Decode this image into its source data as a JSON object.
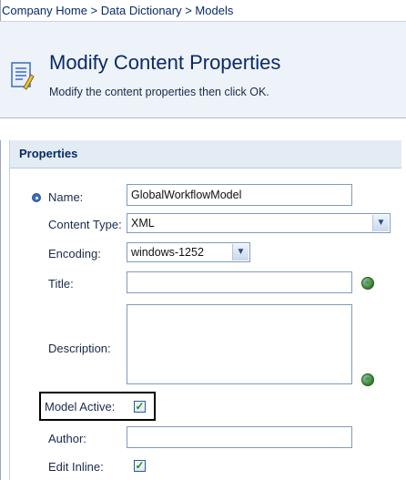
{
  "breadcrumb": {
    "text": "Company Home > Data Dictionary > Models"
  },
  "header": {
    "title": "Modify Content Properties",
    "subtitle": "Modify the content properties then click OK.",
    "icon": "document-edit-icon"
  },
  "panel": {
    "title": "Properties"
  },
  "form": {
    "name_label": "Name:",
    "name_value": "GlobalWorkflowModel",
    "content_type_label": "Content Type:",
    "content_type_value": "XML",
    "encoding_label": "Encoding:",
    "encoding_value": "windows-1252",
    "title_label": "Title:",
    "title_value": "",
    "description_label": "Description:",
    "description_value": "",
    "model_active_label": "Model Active:",
    "model_active_checked": true,
    "author_label": "Author:",
    "author_value": "",
    "edit_inline_label": "Edit Inline:",
    "edit_inline_checked": true
  },
  "checkmark": "✓",
  "dropdown_arrow": "▼",
  "colors": {
    "link": "#0a2a66",
    "header_bg": "#eef3f9",
    "panel_header_bg": "#e3ebf5",
    "checkmark": "#1f8f1f"
  }
}
